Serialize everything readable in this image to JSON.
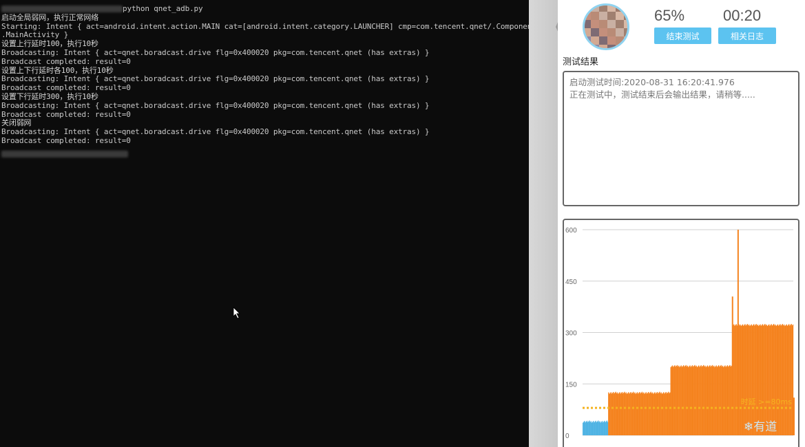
{
  "terminal": {
    "lines": [
      {
        "text": "python qnet_adb.py",
        "zh": false,
        "blur_prefix": true
      },
      {
        "text": "启动全局弱网，执行正常网络",
        "zh": true
      },
      {
        "text": "Starting: Intent { act=android.intent.action.MAIN cat=[android.intent.category.LAUNCHER] cmp=com.tencent.qnet/.Component",
        "zh": false
      },
      {
        "text": ".MainActivity }",
        "zh": false
      },
      {
        "text": "设置上行延时100，执行10秒",
        "zh": true
      },
      {
        "text": "Broadcasting: Intent { act=qnet.boradcast.drive flg=0x400020 pkg=com.tencent.qnet (has extras) }",
        "zh": false
      },
      {
        "text": "Broadcast completed: result=0",
        "zh": false
      },
      {
        "text": "设置上下行延时各100，执行10秒",
        "zh": true
      },
      {
        "text": "Broadcasting: Intent { act=qnet.boradcast.drive flg=0x400020 pkg=com.tencent.qnet (has extras) }",
        "zh": false
      },
      {
        "text": "Broadcast completed: result=0",
        "zh": false
      },
      {
        "text": "设置下行延时300，执行10秒",
        "zh": true
      },
      {
        "text": "Broadcasting: Intent { act=qnet.boradcast.drive flg=0x400020 pkg=com.tencent.qnet (has extras) }",
        "zh": false
      },
      {
        "text": "Broadcast completed: result=0",
        "zh": false
      },
      {
        "text": "关闭弱网",
        "zh": true
      },
      {
        "text": "Broadcasting: Intent { act=qnet.boradcast.drive flg=0x400020 pkg=com.tencent.qnet (has extras) }",
        "zh": false
      },
      {
        "text": "Broadcast completed: result=0",
        "zh": false
      }
    ]
  },
  "app": {
    "progress": "65%",
    "timer": "00:20",
    "end_test_button": "结束测试",
    "related_logs_button": "相关日志",
    "section_title": "测试结果",
    "result_lines": [
      "启动测试时间:2020-08-31 16:20:41.976",
      "正在测试中，测试结束后会输出结果，请稍等....."
    ],
    "threshold_label": "时延 >=80ms",
    "watermark": "有道",
    "colors": {
      "accent": "#5cc3f0",
      "bar_normal": "#4fb3e3",
      "bar_high": "#f5831f",
      "threshold": "#f5b31f"
    }
  },
  "chart_data": {
    "type": "bar",
    "title": "",
    "xlabel": "",
    "ylabel": "",
    "ylim": [
      0,
      600
    ],
    "yticks": [
      "0",
      "150",
      "300",
      "450",
      "600"
    ],
    "threshold": 80,
    "segments": [
      {
        "start": 0,
        "count": 32,
        "value": 40,
        "series": "normal"
      },
      {
        "start": 32,
        "count": 78,
        "value": 124,
        "series": "high"
      },
      {
        "start": 110,
        "count": 78,
        "value": 202,
        "series": "high"
      },
      {
        "start": 188,
        "count": 76,
        "value": 322,
        "series": "high"
      }
    ],
    "spikes": [
      {
        "index": 187,
        "value": 405
      },
      {
        "index": 194,
        "value": 600
      },
      {
        "index": 264,
        "value": 110
      }
    ]
  }
}
